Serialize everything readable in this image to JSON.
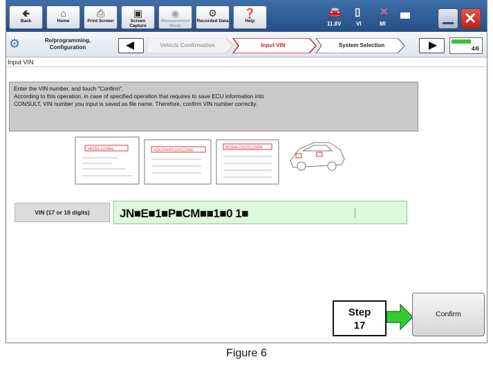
{
  "toolbar": {
    "buttons": [
      {
        "label": "Back",
        "icon": "back-arrow-icon"
      },
      {
        "label": "Home",
        "icon": "home-icon"
      },
      {
        "label": "Print Screen",
        "icon": "printer-icon"
      },
      {
        "label": "Screen Capture",
        "icon": "camera-icon"
      },
      {
        "label": "Measurement Mode",
        "icon": "meter-icon"
      },
      {
        "label": "Recorded Data",
        "icon": "recorded-data-icon"
      },
      {
        "label": "Help",
        "icon": "help-icon"
      }
    ],
    "voltage": "11.8V",
    "vi_label": "VI",
    "mi_label": "MI"
  },
  "breadcrumb": {
    "first": "Re/programming, Configuration",
    "steps": [
      "Vehicle Confirmation",
      "Input VIN",
      "System Selection"
    ],
    "active_step": "Input VIN",
    "progress": "4/6",
    "progress_fraction": 0.67
  },
  "screen_title": "Input VIN",
  "instructions": [
    "Enter the VIN number, and touch \"Confirm\".",
    "According to this operation, in case of specified operation that requires to save ECU information into",
    "CONSULT, VIN number you input is saved as file name. Therefore, confirm VIN number correctly."
  ],
  "labels_image": {
    "label1_vin": "HN251-123456",
    "label2_vin": "VSKJVWR51U0123456",
    "label3_vin": "JN1BAUJ32Z0123456"
  },
  "vin": {
    "label": "VIN (17 or 18 digits)",
    "value": "JN■E■1■P■CM■■1■0 1■"
  },
  "step_box": {
    "line1": "Step",
    "line2": "17"
  },
  "confirm_label": "Confirm",
  "caption": "Figure 6",
  "colors": {
    "toolbar": "#2f5f9a",
    "active_step_border": "#c0272d",
    "vin_field": "#dcf7d9",
    "arrow": "#33cc33"
  }
}
